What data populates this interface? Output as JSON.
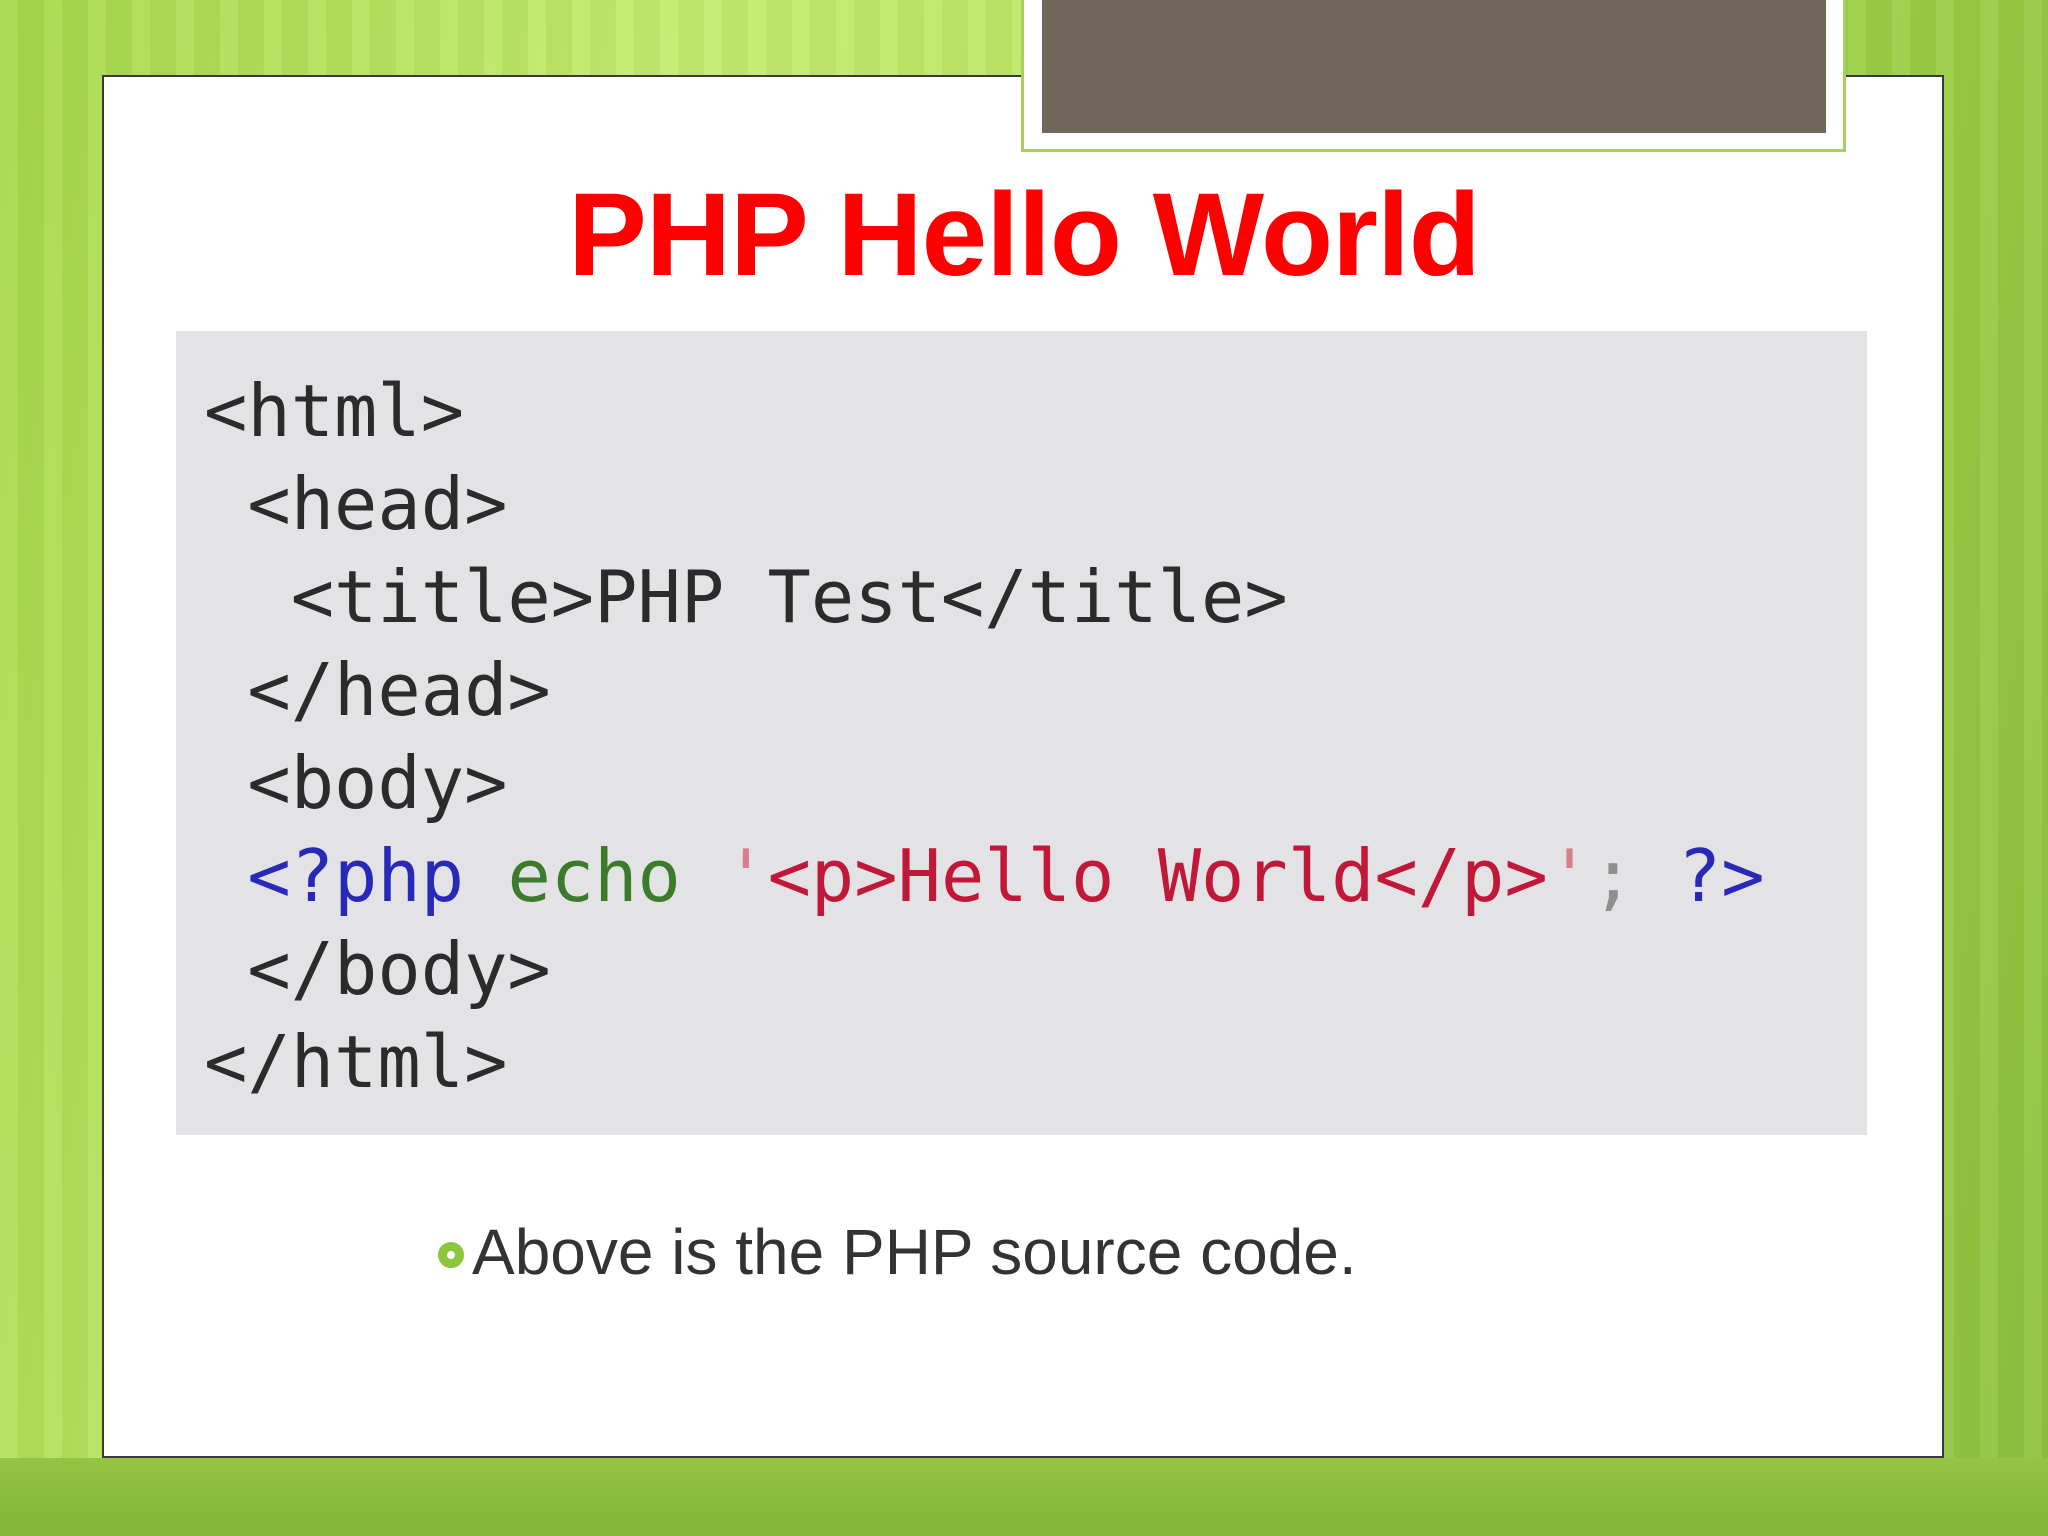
{
  "slide": {
    "title": "PHP Hello World",
    "title_color": "#ff0000",
    "accent_color": "#8cc63f",
    "code": {
      "line1": "<html>",
      "line2": " <head>",
      "line3": "  <title>PHP Test</title>",
      "line4": " </head>",
      "line5": " <body>",
      "line6": {
        "indent": " ",
        "open_tag": "<?php",
        "space1": " ",
        "keyword": "echo",
        "space2": " ",
        "quote_open": "'",
        "string": "<p>Hello World</p>",
        "quote_close": "'",
        "semicolon": ";",
        "space3": " ",
        "close_tag": "?>"
      },
      "line7": " </body>",
      "line8": "</html>"
    },
    "bullets": [
      {
        "icon": "ring-bullet-icon",
        "text": "Above is the PHP source code."
      }
    ]
  }
}
